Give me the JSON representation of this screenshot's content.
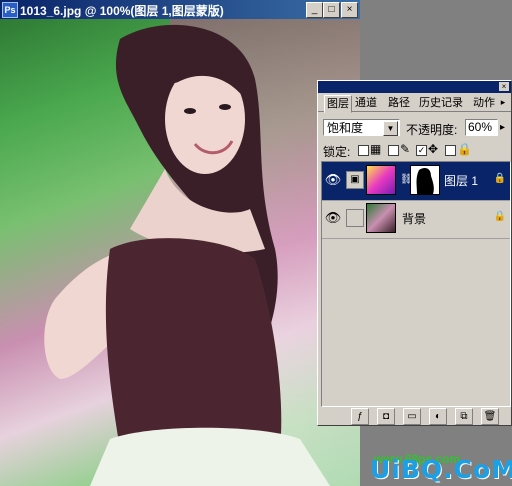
{
  "document": {
    "title": "1013_6.jpg @ 100%(图层 1,图层蒙版)",
    "app_icon": "ps-icon",
    "minimize": "_",
    "maximize": "□",
    "close": "×"
  },
  "palette": {
    "tabs": [
      {
        "label": "图层",
        "active": true
      },
      {
        "label": "通道",
        "active": false
      },
      {
        "label": "路径",
        "active": false
      },
      {
        "label": "历史记录",
        "active": false
      },
      {
        "label": "动作",
        "active": false
      }
    ],
    "blend_mode": "饱和度",
    "opacity_label": "不透明度:",
    "opacity_value": "60%",
    "lock_label": "锁定:",
    "layers": [
      {
        "name": "图层 1",
        "selected": true,
        "has_mask": true
      },
      {
        "name": "背景",
        "selected": false,
        "has_mask": false
      }
    ],
    "watermark_text": "www.68ps.com",
    "bottom_buttons": [
      "layer-style-icon",
      "mask-icon",
      "folder-icon",
      "adjustment-icon",
      "new-layer-icon",
      "trash-icon"
    ]
  },
  "page_watermark": "UiBQ.CoM",
  "colors": {
    "title_active": "#0a246a",
    "selected_row": "#0a246a",
    "watermark_green": "#2ec42e",
    "page_watermark_blue": "#1aa0e6"
  }
}
